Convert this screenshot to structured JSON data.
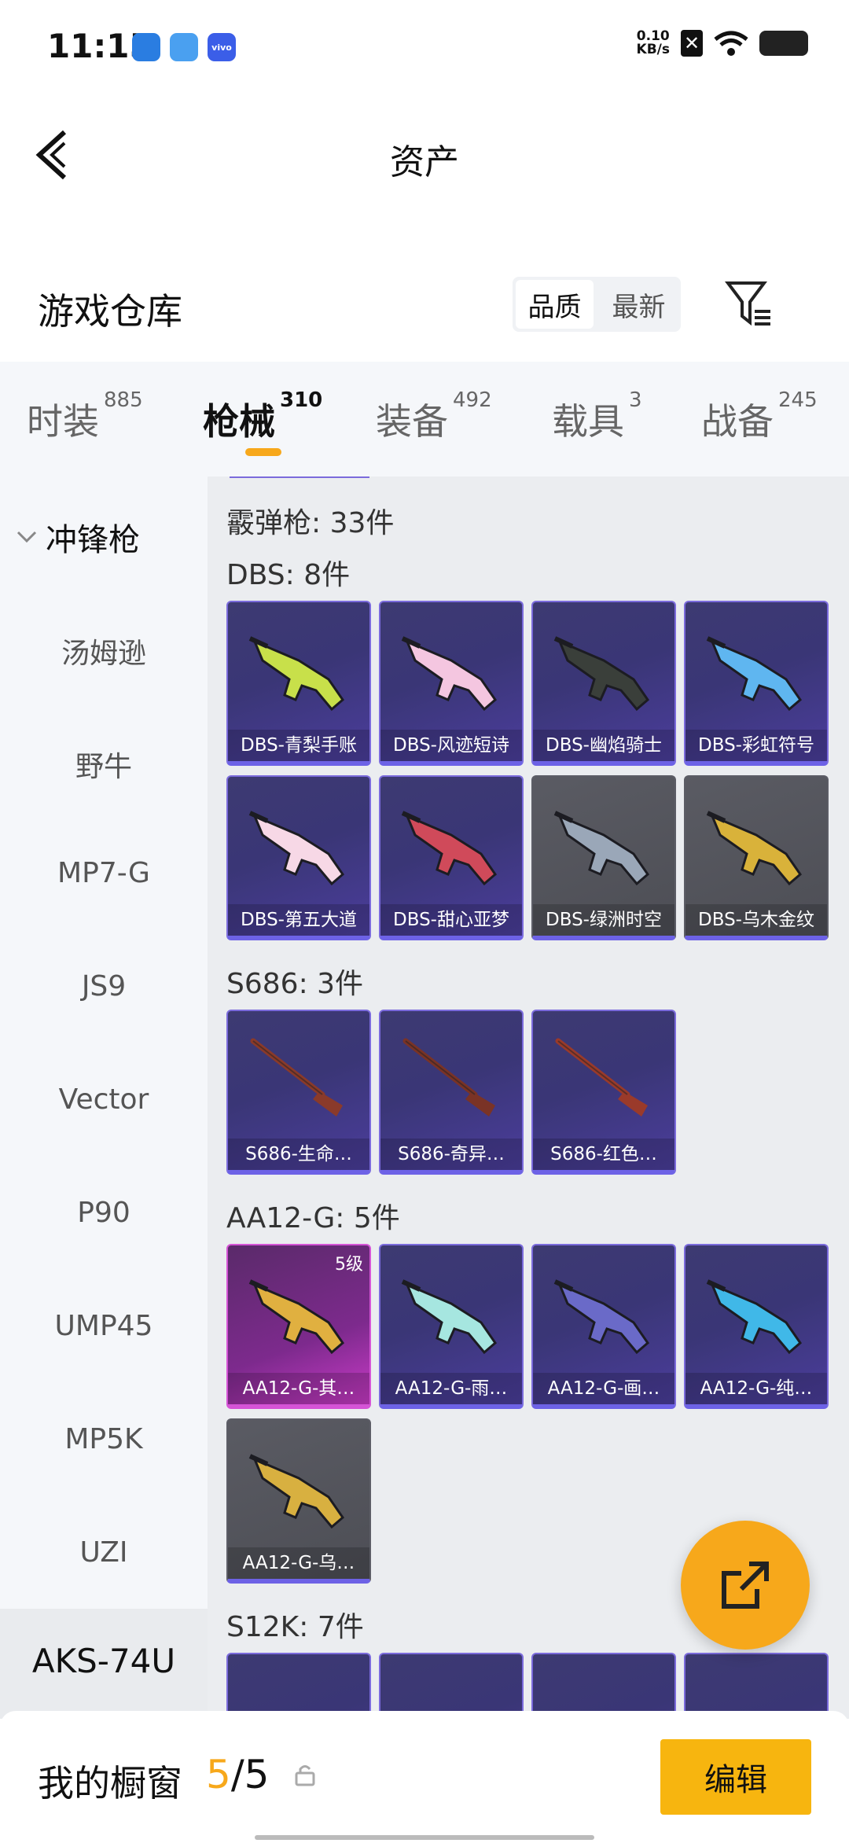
{
  "status": {
    "time": "11:15",
    "net_speed_value": "0.10",
    "net_speed_unit": "KB/s",
    "apps": [
      {
        "name": "app-icon-1",
        "color": "#2a7de1"
      },
      {
        "name": "app-icon-2",
        "color": "#4aa0f0"
      },
      {
        "name": "vivo",
        "color": "#3b5ee8"
      }
    ]
  },
  "header": {
    "title": "资产",
    "back_icon": "back-chevron-icon"
  },
  "warehouse": {
    "title": "游戏仓库",
    "sort_options": [
      "品质",
      "最新"
    ],
    "sort_selected": "品质",
    "filter_icon": "filter-icon"
  },
  "tabs": [
    {
      "label": "时装",
      "count": "885"
    },
    {
      "label": "枪械",
      "count": "310"
    },
    {
      "label": "装备",
      "count": "492"
    },
    {
      "label": "载具",
      "count": "3"
    },
    {
      "label": "战备",
      "count": "245"
    }
  ],
  "active_tab": "枪械",
  "sidebar": {
    "category": "冲锋枪",
    "items": [
      "汤姆逊",
      "野牛",
      "MP7-G",
      "JS9",
      "Vector",
      "P90",
      "UMP45",
      "MP5K",
      "UZI"
    ],
    "selected": "AKS-74U"
  },
  "content": {
    "header": "霰弹枪: 33件",
    "groups": [
      {
        "title": "DBS: 8件",
        "cards": [
          {
            "name": "DBS-青梨手账",
            "bg": "purple",
            "gun": "#c8e04a"
          },
          {
            "name": "DBS-风迹短诗",
            "bg": "purple",
            "gun": "#f4c6e0"
          },
          {
            "name": "DBS-幽焰骑士",
            "bg": "purple",
            "gun": "#3a3f3a"
          },
          {
            "name": "DBS-彩虹符号",
            "bg": "purple",
            "gun": "#5fb6f0"
          },
          {
            "name": "DBS-第五大道",
            "bg": "purple",
            "gun": "#f7d8e6"
          },
          {
            "name": "DBS-甜心亚梦",
            "bg": "purple",
            "gun": "#d04a5a"
          },
          {
            "name": "DBS-绿洲时空",
            "bg": "gray",
            "gun": "#9aa7b8"
          },
          {
            "name": "DBS-乌木金纹",
            "bg": "gray",
            "gun": "#d9b23a"
          }
        ]
      },
      {
        "title": "S686: 3件",
        "cards": [
          {
            "name": "S686-生命…",
            "bg": "purple",
            "gun": "#8a3a2a"
          },
          {
            "name": "S686-奇异…",
            "bg": "purple",
            "gun": "#7a3326"
          },
          {
            "name": "S686-红色…",
            "bg": "purple",
            "gun": "#9a3a2a"
          }
        ]
      },
      {
        "title": "AA12-G: 5件",
        "cards": [
          {
            "name": "AA12-G-其…",
            "bg": "pink",
            "gun": "#e0b040",
            "level": "5级"
          },
          {
            "name": "AA12-G-雨…",
            "bg": "purple",
            "gun": "#a6e6e0"
          },
          {
            "name": "AA12-G-画…",
            "bg": "purple",
            "gun": "#6a6ac8"
          },
          {
            "name": "AA12-G-纯…",
            "bg": "purple",
            "gun": "#40b8e8"
          },
          {
            "name": "AA12-G-乌…",
            "bg": "gray",
            "gun": "#d8b040"
          }
        ]
      },
      {
        "title": "S12K: 7件",
        "cards": []
      }
    ]
  },
  "share_icon": "share-export-icon",
  "bottom": {
    "label": "我的橱窗",
    "current": "5",
    "separator": "/",
    "total": "5",
    "lock_icon": "lock-icon",
    "edit_label": "编辑"
  },
  "colors": {
    "accent": "#f7a81b",
    "card_purple": "#3d3a72",
    "card_border": "#6d62e6"
  }
}
